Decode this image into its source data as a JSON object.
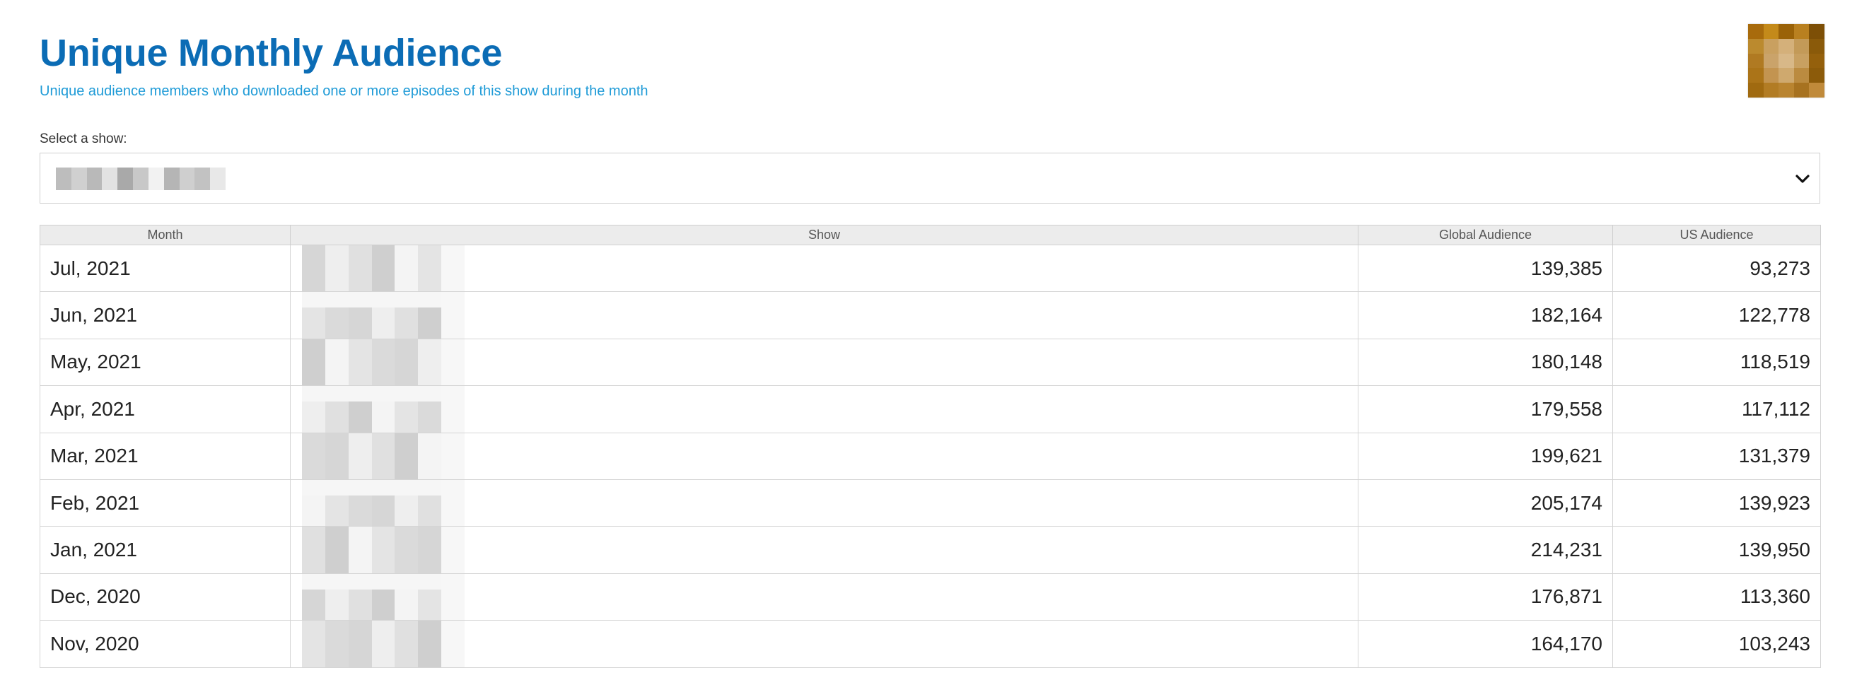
{
  "header": {
    "title": "Unique Monthly Audience",
    "subtitle": "Unique audience members who downloaded one or more episodes of this show during the month",
    "logo_icon": "pixelated-show-logo"
  },
  "show_select": {
    "label": "Select a show:",
    "selected_value_redacted": true,
    "dropdown_icon": "chevron-down-icon"
  },
  "table": {
    "columns": [
      "Month",
      "Show",
      "Global Audience",
      "US Audience"
    ],
    "rows": [
      {
        "month": "Jul, 2021",
        "global": "139,385",
        "us": "93,273"
      },
      {
        "month": "Jun, 2021",
        "global": "182,164",
        "us": "122,778"
      },
      {
        "month": "May, 2021",
        "global": "180,148",
        "us": "118,519"
      },
      {
        "month": "Apr, 2021",
        "global": "179,558",
        "us": "117,112"
      },
      {
        "month": "Mar, 2021",
        "global": "199,621",
        "us": "131,379"
      },
      {
        "month": "Feb, 2021",
        "global": "205,174",
        "us": "139,923"
      },
      {
        "month": "Jan, 2021",
        "global": "214,231",
        "us": "139,950"
      },
      {
        "month": "Dec, 2020",
        "global": "176,871",
        "us": "113,360"
      },
      {
        "month": "Nov, 2020",
        "global": "164,170",
        "us": "103,243"
      }
    ]
  },
  "colors": {
    "title": "#0b6cb5",
    "subtitle": "#1f9bd7",
    "header_bg": "#ececec",
    "logo": "#b27a16"
  }
}
